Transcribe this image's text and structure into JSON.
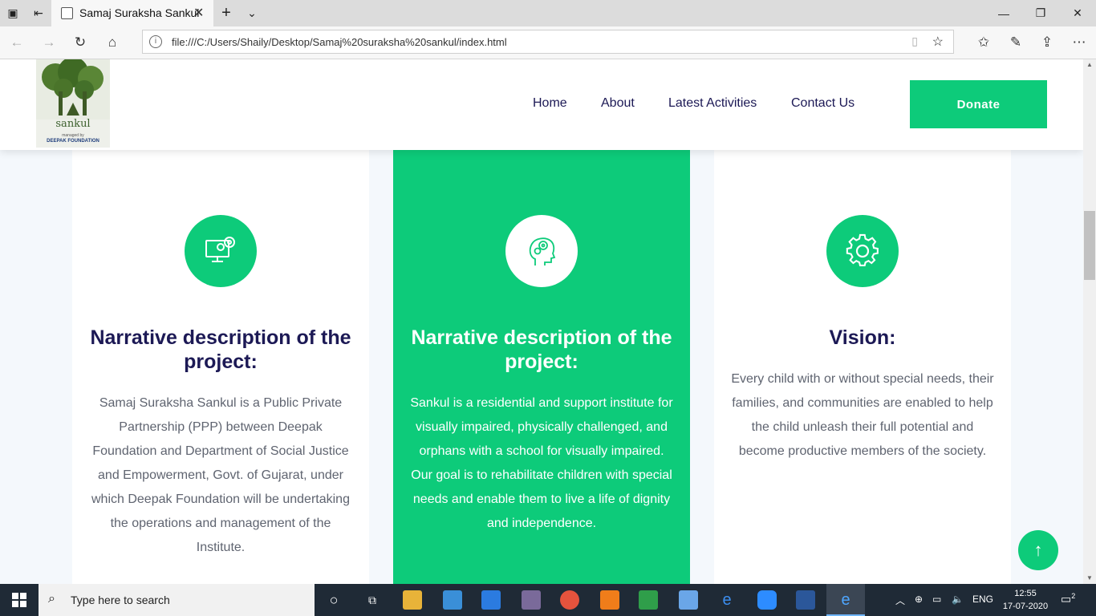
{
  "browser": {
    "tab_title": "Samaj Suraksha Sankul",
    "url": "file:///C:/Users/Shaily/Desktop/Samaj%20suraksha%20sankul/index.html"
  },
  "header": {
    "logo": {
      "title": "sankul",
      "subtitle": "managed by",
      "org": "DEEPAK FOUNDATION"
    },
    "nav": [
      "Home",
      "About",
      "Latest Activities",
      "Contact Us"
    ],
    "donate_label": "Donate"
  },
  "cards": [
    {
      "title": "Narrative description of the project:",
      "text": "Samaj Suraksha Sankul is a Public Private Partnership (PPP) between Deepak Foundation and Department of Social Justice and Empowerment, Govt. of Gujarat, under which Deepak Foundation will be undertaking the operations and management of the Institute.",
      "icon": "monitor-gear-icon"
    },
    {
      "title": "Narrative description of the project:",
      "text": "Sankul is a residential and support institute for visually impaired, physically challenged, and orphans with a school for visually impaired. Our goal is to rehabilitate children with special needs and enable them to live a life of dignity and independence.",
      "icon": "head-gears-icon"
    },
    {
      "title": "Vision:",
      "text": "Every child with or without special needs, their families, and communities are enabled to help the child unleash their full potential and become productive members of the society.",
      "icon": "gear-icon"
    }
  ],
  "taskbar": {
    "search_placeholder": "Type here to search",
    "lang": "ENG",
    "time": "12:55",
    "date": "17-07-2020",
    "notifications": "2"
  },
  "colors": {
    "accent": "#0dcb7a",
    "heading": "#1c1955",
    "body_text": "#5f6470"
  }
}
